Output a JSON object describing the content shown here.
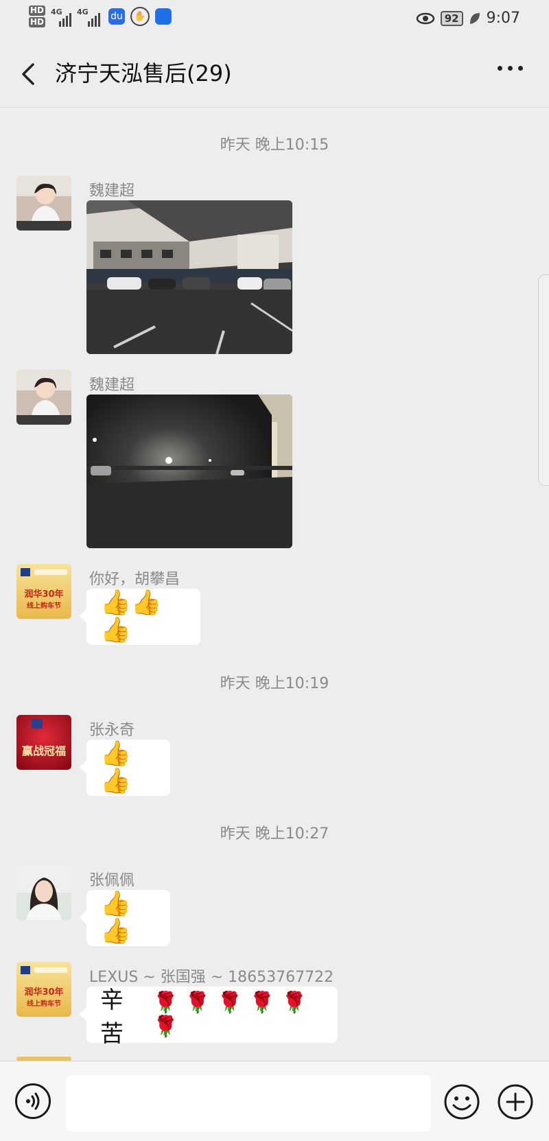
{
  "status": {
    "hd1": "HD",
    "hd2": "HD",
    "net1": "4G",
    "net2": "4G",
    "battery": "92",
    "time": "9:07"
  },
  "header": {
    "title": "济宁天泓售后(29)"
  },
  "timestamps": [
    "昨天 晚上10:15",
    "昨天 晚上10:19",
    "昨天 晚上10:27"
  ],
  "messages": [
    {
      "sender": "魏建超",
      "type": "image"
    },
    {
      "sender": "魏建超",
      "type": "image"
    },
    {
      "sender": "你好，胡攀昌",
      "type": "text",
      "content": "👍👍👍"
    },
    {
      "sender": "张永奇",
      "type": "text",
      "content": "👍👍"
    },
    {
      "sender": "张佩佩",
      "type": "text",
      "content": "👍👍"
    },
    {
      "sender": "LEXUS ~ 张国强 ~ 18653767722",
      "type": "text",
      "content": "辛苦",
      "roses": "🌹 🌹 🌹 🌹 🌹 🌹"
    }
  ],
  "avatar_text": {
    "promo_1": "润华30年",
    "promo_1_sub": "线上购车节",
    "promo_2": "赢战冠福"
  },
  "input": {
    "value": ""
  },
  "icons": [
    "back-icon",
    "more-icon",
    "voice-icon",
    "emoji-icon",
    "plus-icon"
  ],
  "colors": {
    "background": "#ededed",
    "bubble": "#ffffff",
    "meta_text": "#8a8a8a"
  }
}
